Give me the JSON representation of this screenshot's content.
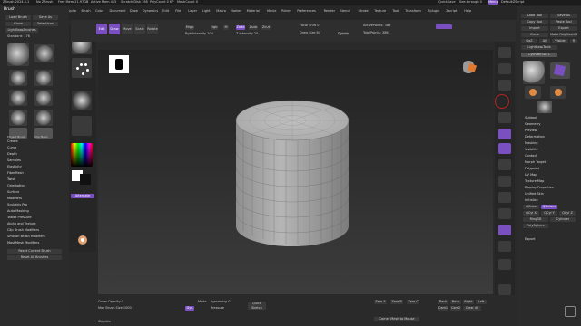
{
  "title_bar": {
    "app": "ZBrush 2024.0.1",
    "items": [
      "No ZBrush",
      "Free Mem 21.97GB",
      "Active Mem 415",
      "Scratch Disk 198",
      "PolyCount 0 KP",
      "MeshCount 0"
    ],
    "quicksave": "QuickSave",
    "see_through": "See-through 0",
    "menus": "Menus",
    "default_script": "DefaultZScript"
  },
  "menubar": {
    "items": [
      "Alpha",
      "Brush",
      "Color",
      "Document",
      "Draw",
      "Dynamics",
      "Edit",
      "File",
      "Layer",
      "Light",
      "Macro",
      "Marker",
      "Material",
      "Movie",
      "Picker",
      "Preferences",
      "Render",
      "Stencil",
      "Stroke",
      "Texture",
      "Tool",
      "Transform",
      "Zplugin",
      "Zscript",
      "Help"
    ]
  },
  "left_panel": {
    "header": "Brush",
    "buttons": [
      "Load Brush",
      "Save As",
      "Clone",
      "SelectIcon",
      "LightBox▸Brushes"
    ],
    "standard_label": "Standard: 176",
    "brush_names": [
      "Standard",
      "ClayBuildup",
      "Move",
      "DamStandard",
      "hPolish",
      "TrimDynamic",
      "Pinch",
      "Inflat",
      "Move Topological",
      "Slash3",
      "Snakehook",
      "Transpose",
      "Project Brush",
      "Clip Mesh"
    ],
    "sections": [
      "Create",
      "Curve",
      "Depth",
      "Samples",
      "Elasticity",
      "FiberMesh",
      "Twist",
      "Orientation",
      "Surface",
      "Modifiers",
      "Sculptris Pro",
      "Auto Masking",
      "Tablet Pressure",
      "Alpha and Texture",
      "Clip Brush Modifiers",
      "Smooth Brush Modifiers",
      "MaskMesh Modifiers"
    ],
    "reset_buttons": [
      "Reset Current Brush",
      "Reset All Brushes"
    ]
  },
  "brush_column": {
    "label": "Lint Brushes",
    "items": [
      "Standard",
      "Dots",
      "Alpha Off",
      "Texture Off",
      "Gradient",
      "SwitchColor",
      "Alternate"
    ]
  },
  "toolbar": {
    "edit": "Edit",
    "draw": "Draw",
    "move": "Move",
    "scale": "Scale",
    "rotate": "Rotate",
    "mrgb": "Mrgb",
    "rgb": "Rgb",
    "m": "M",
    "zadd": "Zadd",
    "zsub": "Zsub",
    "zcut": "Zcut",
    "rgb_intensity": "Rgb Intensity 100",
    "z_intensity": "Z Intensity 25",
    "focal_shift": "Focal Shift 0",
    "draw_size": "Draw Size 64",
    "dynamic": "Dynamic",
    "active_points": "ActivePoints: 386",
    "total_points": "TotalPoints: 386"
  },
  "right_panel": {
    "buttons": [
      "Load Tool",
      "Save As",
      "Copy Tool",
      "Paste Tool",
      "Import",
      "Export",
      "Clone",
      "Make PolyMesh3D",
      "GoZ",
      "All",
      "Visible",
      "R"
    ],
    "lightbox": "Lightbox▸Tools",
    "tool_name": "Cylinder3D: 1",
    "tools": [
      "Cylinder3D",
      "PolyMesh3D",
      "SimpleBrush",
      "EraserBrush",
      "Cylinder3D"
    ],
    "sections": [
      "Subtool",
      "Geometry",
      "Preview",
      "Deformation",
      "Masking",
      "Visibility",
      "Contact",
      "Morph Target",
      "Polypaint",
      "UV Map",
      "Texture Map",
      "Display Properties",
      "Unified Skin",
      "Initialize"
    ],
    "initialize_items": [
      "QCube",
      "QSphere",
      "QCyl X",
      "QCyl Y",
      "QCyl Z",
      "Ring3D",
      "Cylinder",
      "PolySphere"
    ],
    "export": "Export"
  },
  "right_strip": {
    "items": [
      "BPR",
      "SPix 3",
      "Scroll",
      "Zoom",
      "Actual",
      "AAHalf",
      "Persp",
      "Floor",
      "Local",
      "LSym",
      "Frame",
      "Move",
      "Zoom3D",
      "Rotate",
      "PolyF",
      "Transp",
      "Solo",
      "Xpose"
    ]
  },
  "bottom_bar": {
    "outer_opacity": "Outer Opacity 0",
    "max_brush_size": "Max Brush Size 1000",
    "dyn": "Dyn",
    "mode": "Mode",
    "pressure": "Pressure",
    "symmetry": "Symmetry 0",
    "sketch_button": "Quick Sketch",
    "zero_a": "Zero A",
    "zero_b": "Zero B",
    "zero_c": "Zero C",
    "back": "Back",
    "back_btn": "Back",
    "right": "Right",
    "left": "Left",
    "front": "Front",
    "cam": "Cam1",
    "cam2": "Cam2",
    "cam3": "Cam3",
    "cam_all": "Clear All",
    "corner_mesh": "Corner Mesh to Mouse",
    "status": "Skipdim"
  },
  "colors": {
    "accent": "#7a4fc0",
    "background": "#2a2a2a",
    "mesh": "#b8b8b8"
  }
}
